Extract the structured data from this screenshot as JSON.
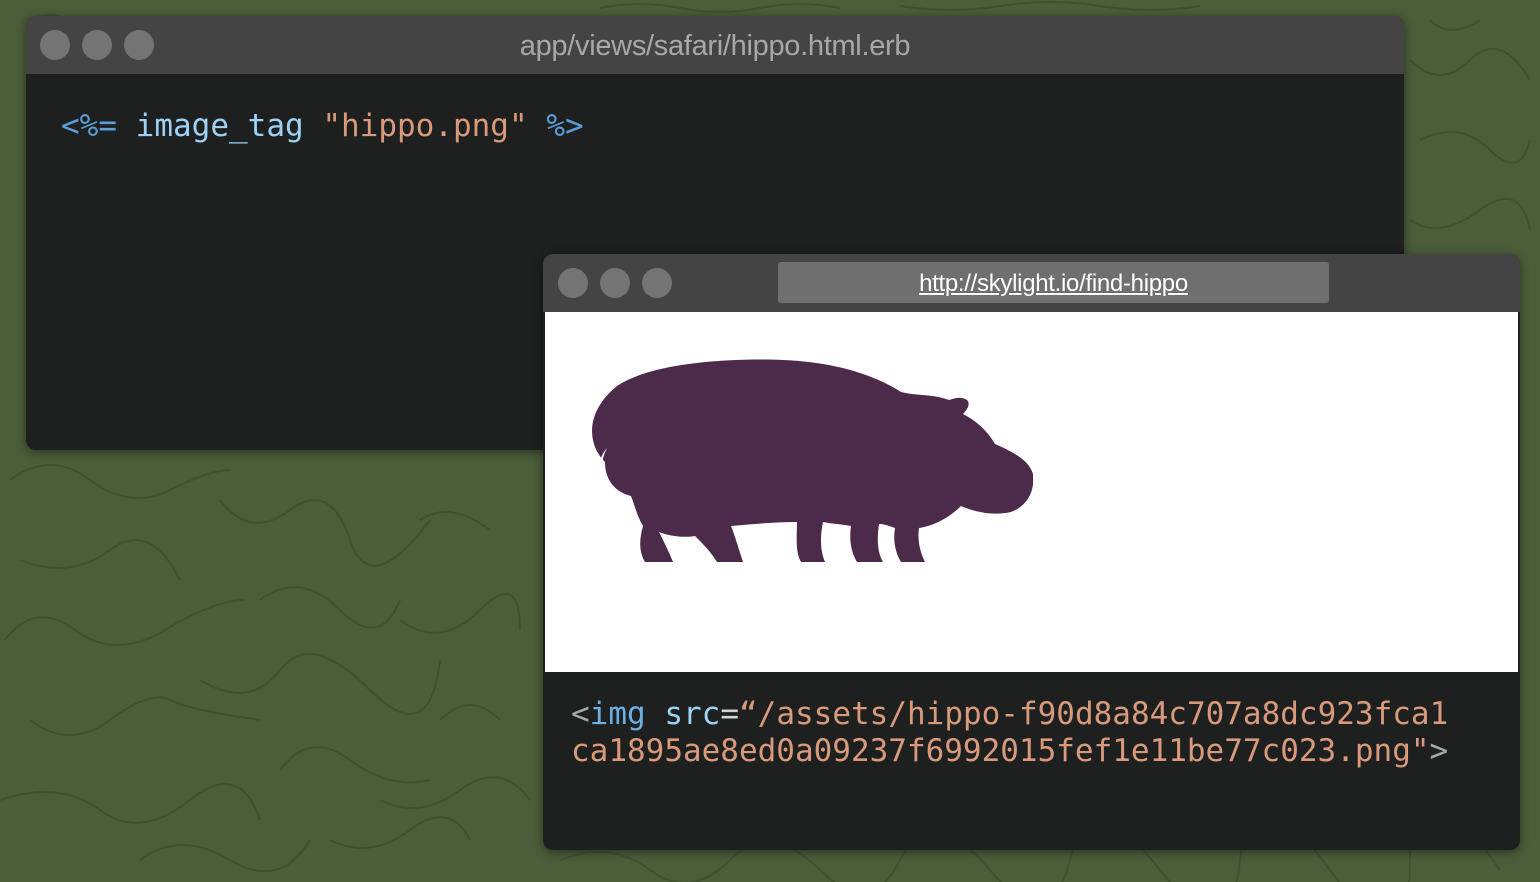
{
  "editor": {
    "title": "app/views/safari/hippo.html.erb",
    "code": {
      "erb_open": "<%=",
      "method": "image_tag",
      "argument": "\"hippo.png\"",
      "erb_close": "%>"
    }
  },
  "browser": {
    "url": "http://skylight.io/find-hippo",
    "image_icon": "hippo-silhouette",
    "image_color": "#4c2a4a",
    "html_output": {
      "open_bracket": "<",
      "tag": "img",
      "attr": "src",
      "equals": "=",
      "src_line1": "“/assets/hippo-f90d8a84c707a8dc923fca1",
      "src_line2": "ca1895ae8ed0a09237f6992015fef1e11be77c023.png\"",
      "close_bracket": ">"
    }
  },
  "colors": {
    "background": "#4b5d39",
    "titlebar": "#444444",
    "editor_bg": "#1e1f1f",
    "erb_delimiter": "#5a9fd9",
    "method": "#9cd2f4",
    "string": "#d99a7b"
  }
}
